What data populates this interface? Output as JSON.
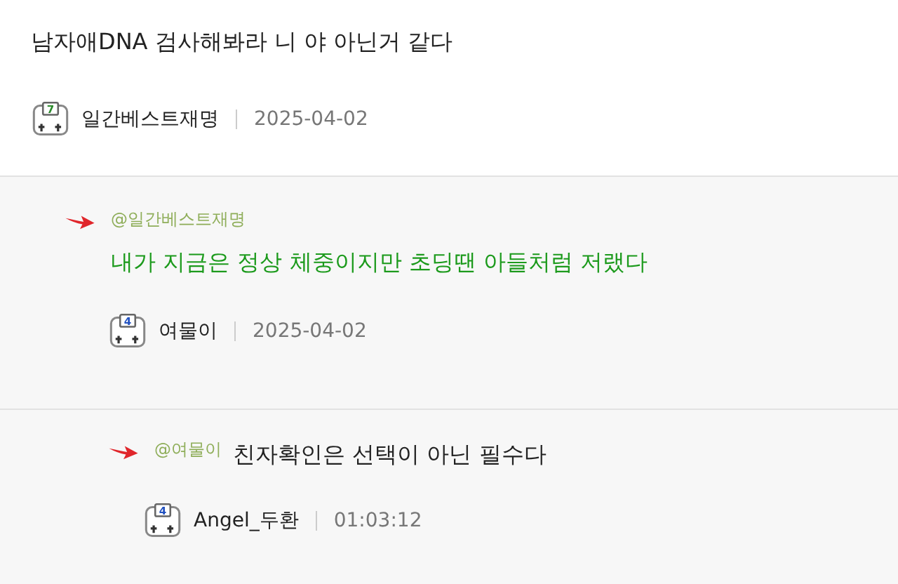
{
  "post": {
    "title": "남자애DNA 검사해봐라 니 야 아닌거 같다",
    "author": {
      "badge": "7",
      "name": "일간베스트재명",
      "time": "2025-04-02"
    }
  },
  "comments": [
    {
      "kind": "mention_above",
      "mention": "@일간베스트재명",
      "text": "내가 지금은 정상 체중이지만 초딩땐 아들처럼 저랬다",
      "highlighted": true,
      "author": {
        "badge": "4",
        "name": "여물이",
        "time": "2025-04-02"
      },
      "children": [
        {
          "kind": "mention_inline",
          "mention": "@여물이",
          "text": "친자확인은 선택이 아닌 필수다",
          "highlighted": false,
          "author": {
            "badge": "4",
            "name": "Angel_두환",
            "time": "01:03:12"
          }
        }
      ]
    }
  ]
}
